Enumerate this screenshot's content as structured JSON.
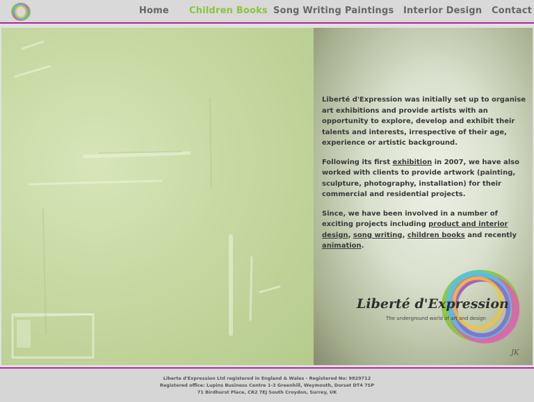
{
  "nav": {
    "items": [
      {
        "label": "Home"
      },
      {
        "label": "Children Books"
      },
      {
        "label": "Song Writing"
      },
      {
        "label": "Paintings"
      },
      {
        "label": "Interior Design"
      },
      {
        "label": "Contact"
      }
    ],
    "active": "Children Books"
  },
  "content": {
    "p1": "Liberté d'Expression was initially set up to organise art exhibitions and provide artists with an opportunity to explore, develop and exhibit their talents and interests, irrespective of their age, experience or artistic background.",
    "p2_before": "Following its first ",
    "p2_link": "exhibition",
    "p2_after": " in 2007, we have also worked with clients to provide artwork (painting, sculpture, photography, installation) for their commercial and residential projects.",
    "p3_before": "Since, we have been involved in a number of exciting projects including ",
    "p3_link1": "product and interior design",
    "p3_sep1": ", ",
    "p3_link2": "song writing",
    "p3_sep2": ", ",
    "p3_link3": "children books",
    "p3_mid": " and recently ",
    "p3_link4": "animation",
    "p3_end": "."
  },
  "brand": {
    "name": "Liberté d'Expression",
    "tagline": "The underground world of art and design",
    "signature": "JK"
  },
  "colors": {
    "accent_line": "#b1289c",
    "nav_active": "#8ac43a",
    "nav_default": "#666666"
  },
  "footer": {
    "line1": "Liberte d'Expression Ltd registered in England & Wales - Registered No: 9829712",
    "line2": "Registered office: Lupins Business Centre 1-3 Greenhill, Weymouth, Dorset DT4 7SP",
    "line3": "71 Birdhurst Place, CR2 7EJ South Croydon, Surrey, UK"
  }
}
